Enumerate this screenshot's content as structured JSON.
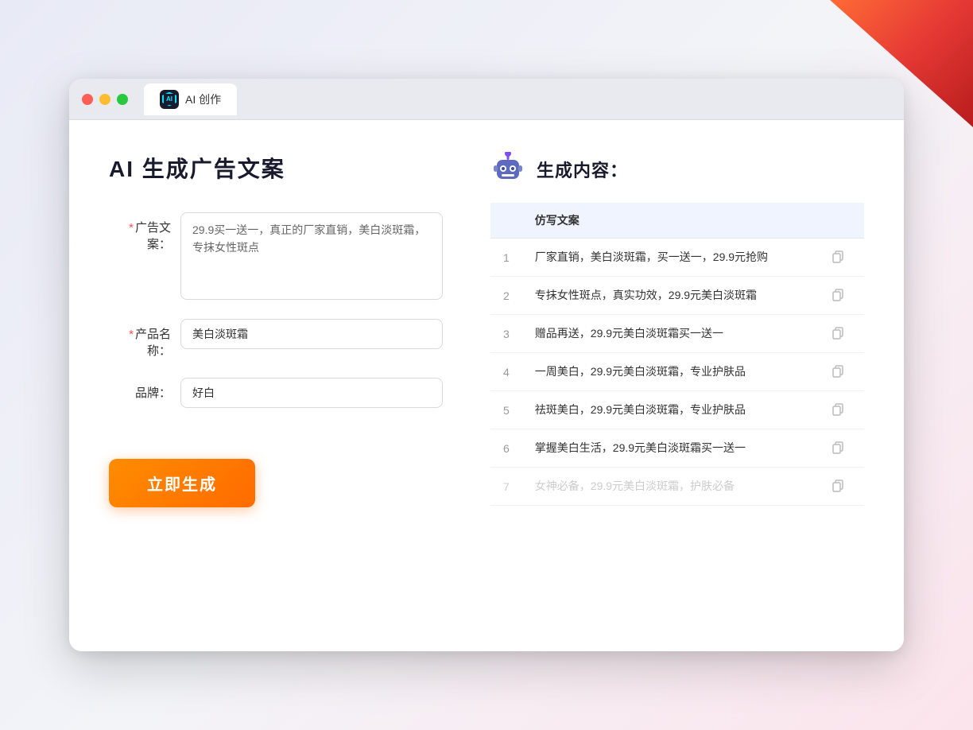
{
  "window": {
    "tab_label": "AI 创作",
    "ai_icon_text": "AI"
  },
  "left_panel": {
    "title": "AI 生成广告文案",
    "form": {
      "ad_copy_label": "广告文案：",
      "ad_copy_required": "*",
      "ad_copy_value": "29.9买一送一，真正的厂家直销，美白淡斑霜，专抹女性斑点",
      "product_name_label": "产品名称：",
      "product_name_required": "*",
      "product_name_value": "美白淡斑霜",
      "brand_label": "品牌：",
      "brand_value": "好白"
    },
    "generate_button": "立即生成"
  },
  "right_panel": {
    "title": "生成内容：",
    "table_header": "仿写文案",
    "results": [
      {
        "id": 1,
        "text": "厂家直销，美白淡斑霜，买一送一，29.9元抢购"
      },
      {
        "id": 2,
        "text": "专抹女性斑点，真实功效，29.9元美白淡斑霜"
      },
      {
        "id": 3,
        "text": "赠品再送，29.9元美白淡斑霜买一送一"
      },
      {
        "id": 4,
        "text": "一周美白，29.9元美白淡斑霜，专业护肤品"
      },
      {
        "id": 5,
        "text": "祛斑美白，29.9元美白淡斑霜，专业护肤品"
      },
      {
        "id": 6,
        "text": "掌握美白生活，29.9元美白淡斑霜买一送一"
      },
      {
        "id": 7,
        "text": "女神必备，29.9元美白淡斑霜，护肤必备",
        "faded": true
      }
    ]
  },
  "colors": {
    "orange": "#ff6b00",
    "purple": "#5c6bc0",
    "accent_blue": "#4096ff"
  }
}
